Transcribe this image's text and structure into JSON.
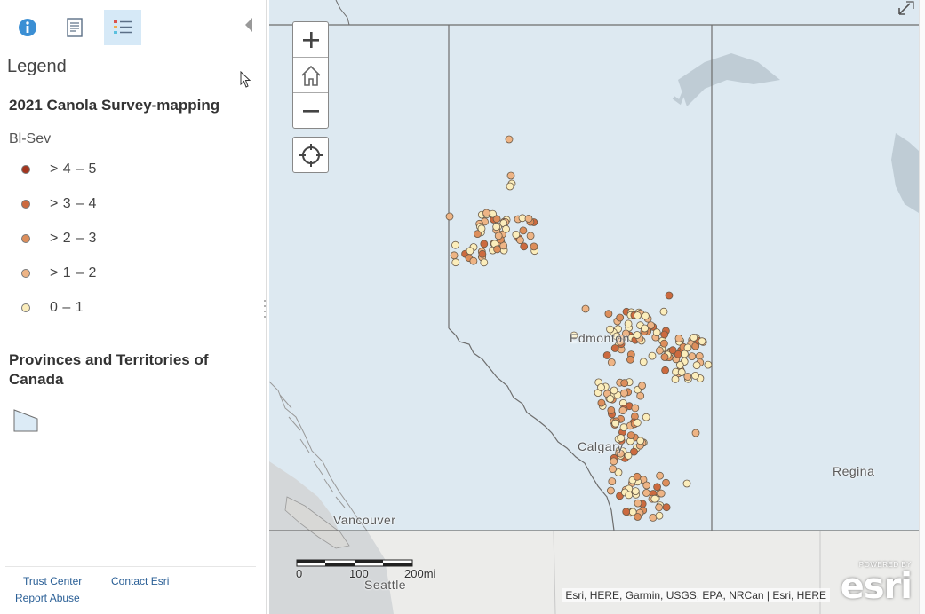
{
  "panel": {
    "tabs": [
      {
        "name": "about",
        "icon": "info-icon"
      },
      {
        "name": "content",
        "icon": "document-icon"
      },
      {
        "name": "legend",
        "icon": "legend-list-icon",
        "active": true
      }
    ],
    "legend_heading": "Legend",
    "layers": [
      {
        "title": "2021 Canola Survey-mapping",
        "field": "Bl-Sev",
        "classes": [
          {
            "label": "> 4 – 5",
            "color": "#a4351e"
          },
          {
            "label": "> 3 – 4",
            "color": "#cc6a3f"
          },
          {
            "label": "> 2 – 3",
            "color": "#dd8e5b"
          },
          {
            "label": "> 1 – 2",
            "color": "#eeb485"
          },
          {
            "label": "0 – 1",
            "color": "#fbedbb"
          }
        ]
      },
      {
        "title": "Provinces and Territories of Canada",
        "fill": "#dcebf6"
      }
    ],
    "footer": {
      "trust": "Trust Center",
      "contact": "Contact Esri",
      "abuse": "Report Abuse"
    }
  },
  "map": {
    "colors": {
      "land": "#dde9f1",
      "outside": "#ececea",
      "water": "#bfccd5",
      "border": "#6e6e6e"
    },
    "labels": {
      "edmonton": "Edmonton",
      "calgary": "Calgary",
      "regina": "Regina",
      "vancouver": "Vancouver",
      "seattle": "Seattle"
    },
    "scale": {
      "labels": [
        "0",
        "100",
        "200mi"
      ]
    },
    "attribution": "Esri, HERE, Garmin, USGS, EPA, NRCan | Esri, HERE",
    "logo": {
      "powered": "POWERED BY",
      "word": "esri"
    },
    "controls": [
      "zoom-in",
      "home",
      "zoom-out",
      "locate",
      "expand"
    ]
  }
}
